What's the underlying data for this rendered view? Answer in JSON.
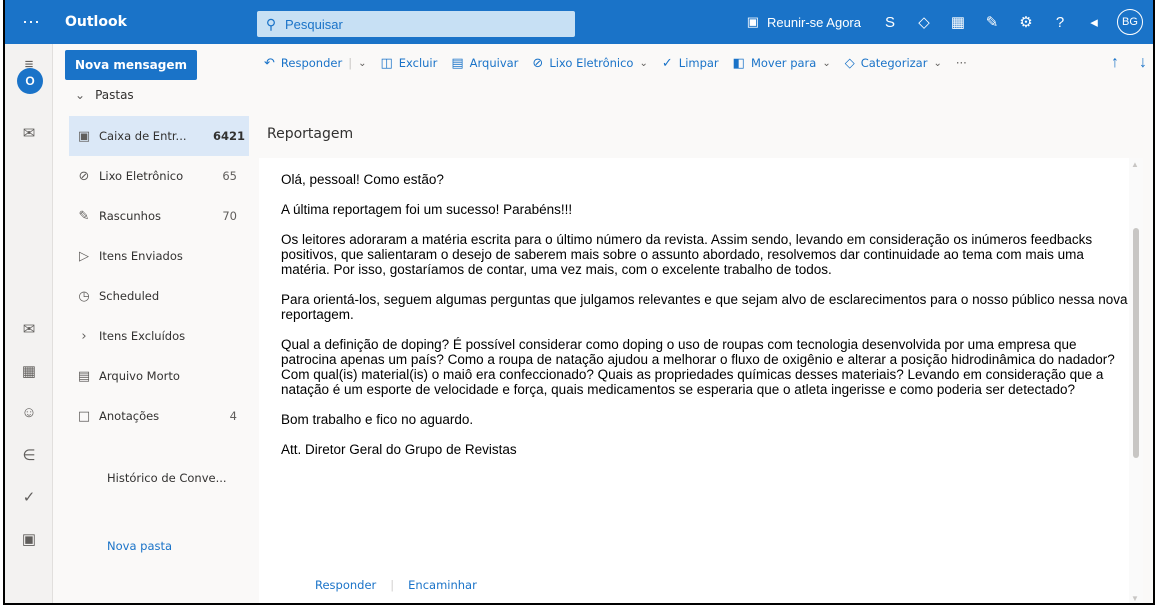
{
  "app": {
    "brand": "Outlook",
    "accent": "#1a73c8",
    "search_placeholder": "Pesquisar"
  },
  "topbar": {
    "meet_label": "Reunir-se Agora",
    "avatar_initials": "BG",
    "icons": [
      "skype-icon",
      "diamond-icon",
      "office-icon",
      "feedback-icon",
      "settings-gear-icon",
      "help-icon",
      "megaphone-icon"
    ]
  },
  "command_bar": {
    "new_message": "Nova mensagem",
    "reply": "Responder",
    "delete": "Excluir",
    "archive": "Arquivar",
    "junk": "Lixo Eletrônico",
    "sweep": "Limpar",
    "move_to": "Mover para",
    "categorize": "Categorizar",
    "more": "···"
  },
  "folders": {
    "header": "Pastas",
    "items": [
      {
        "label": "Caixa de Entr...",
        "count": "6421"
      },
      {
        "label": "Lixo Eletrônico",
        "count": "65"
      },
      {
        "label": "Rascunhos",
        "count": "70"
      },
      {
        "label": "Itens Enviados",
        "count": ""
      },
      {
        "label": "Scheduled",
        "count": ""
      },
      {
        "label": "Itens Excluídos",
        "count": ""
      },
      {
        "label": "Arquivo Morto",
        "count": ""
      },
      {
        "label": "Anotações",
        "count": "4"
      }
    ],
    "history": "Histórico de Conve...",
    "new_folder": "Nova pasta"
  },
  "message": {
    "subject": "Reportagem",
    "p1": "Olá, pessoal! Como estão?",
    "p2": "A última reportagem foi um sucesso! Parabéns!!!",
    "p3": "Os leitores adoraram a matéria escrita para o último número da revista. Assim sendo, levando em consideração os inúmeros feedbacks positivos, que salientaram o desejo de saberem mais sobre o assunto abordado, resolvemos dar continuidade ao tema com mais uma matéria. Por isso, gostaríamos de contar, uma vez mais, com o excelente trabalho de todos.",
    "p4": "Para orientá-los, seguem algumas perguntas que julgamos relevantes e que sejam alvo de esclarecimentos para o nosso público nessa nova reportagem.",
    "p5": "Qual a definição de doping? É possível considerar como doping o uso de roupas com tecnologia desenvolvida por uma empresa que patrocina apenas um país? Como a roupa de natação ajudou a melhorar o fluxo de oxigênio e alterar a posição hidrodinâmica do nadador? Com qual(is) material(is) o maiô era confeccionado? Quais as propriedades químicas desses materiais? Levando em consideração que a natação é um esporte de velocidade e força, quais medicamentos se esperaria que o atleta ingerisse e como poderia ser detectado?",
    "p6": "Bom trabalho e fico no aguardo.",
    "p7": "Att. Diretor Geral do Grupo de Revistas",
    "reply_action": "Responder",
    "forward_action": "Encaminhar"
  }
}
